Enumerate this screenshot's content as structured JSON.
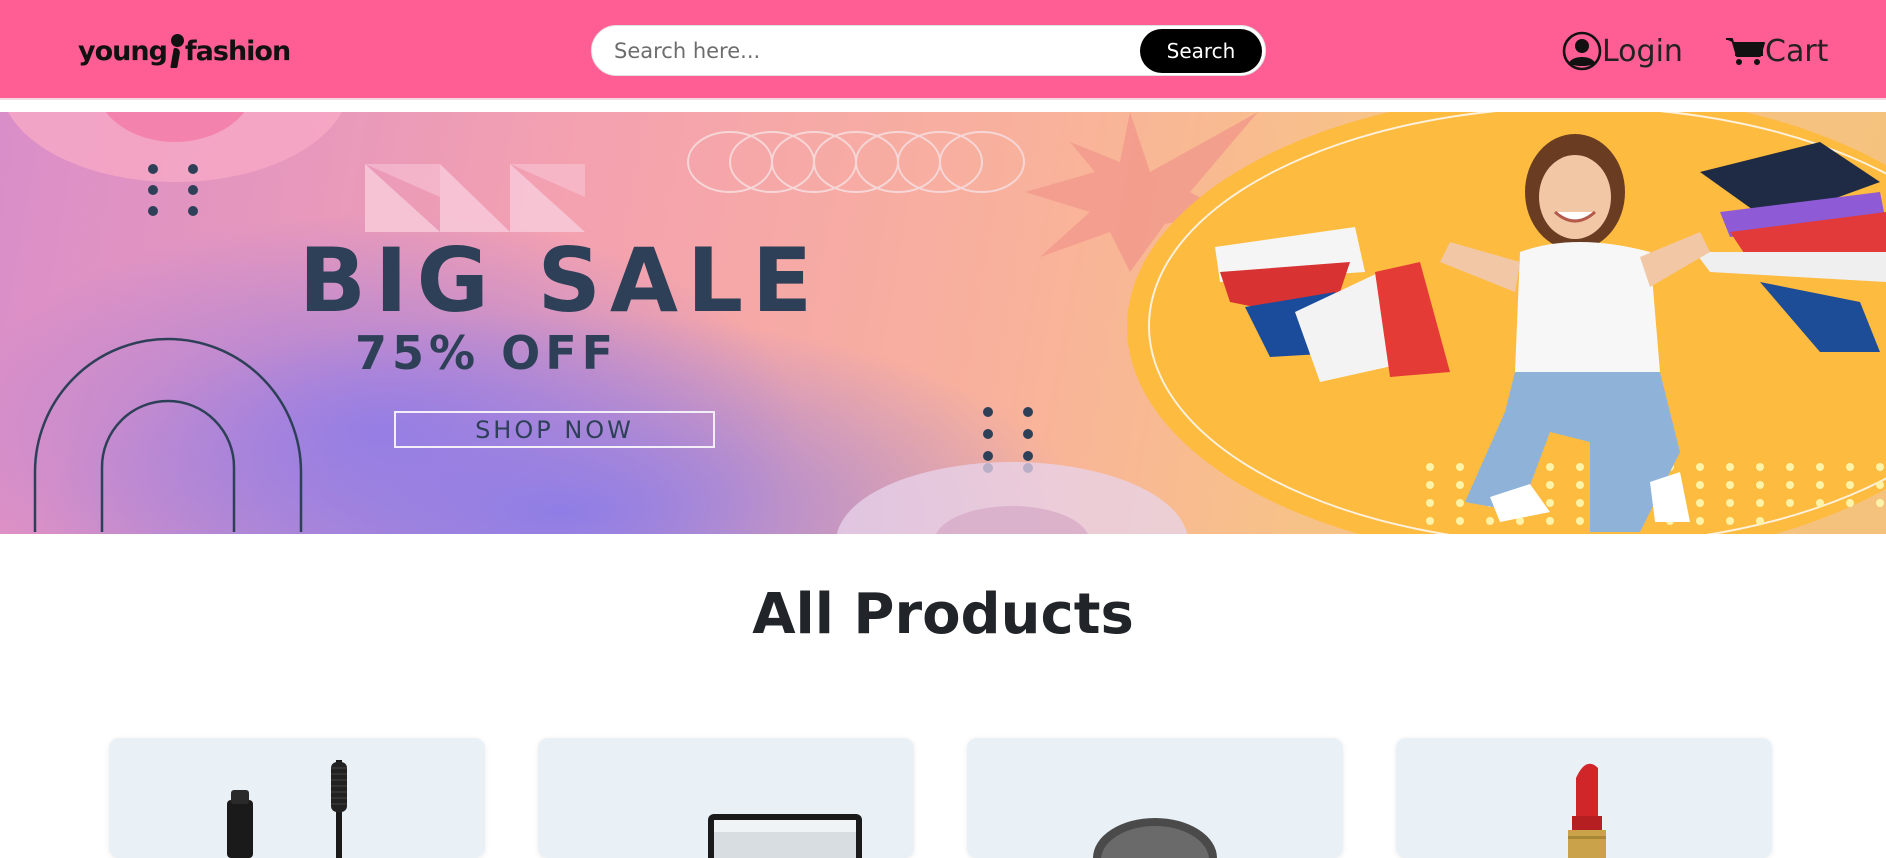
{
  "header": {
    "logo_text_left": "young",
    "logo_text_right": "fashion",
    "search": {
      "placeholder": "Search here...",
      "button_label": "Search"
    },
    "nav": {
      "login_label": "Login",
      "cart_label": "Cart",
      "login_icon": "user-circle-icon",
      "cart_icon": "cart-icon"
    }
  },
  "banner": {
    "title": "BIG SALE",
    "subtitle": "75% OFF",
    "cta_label": "SHOP NOW"
  },
  "products_section": {
    "title": "All Products",
    "cards": [
      {
        "image": "mascara-image"
      },
      {
        "image": "mirror-image"
      },
      {
        "image": "compact-image"
      },
      {
        "image": "lipstick-image"
      }
    ]
  },
  "colors": {
    "header_bg": "#ff5e94",
    "search_button": "#000000",
    "banner_text": "#2e4058",
    "card_bg": "#e9f0f6"
  }
}
